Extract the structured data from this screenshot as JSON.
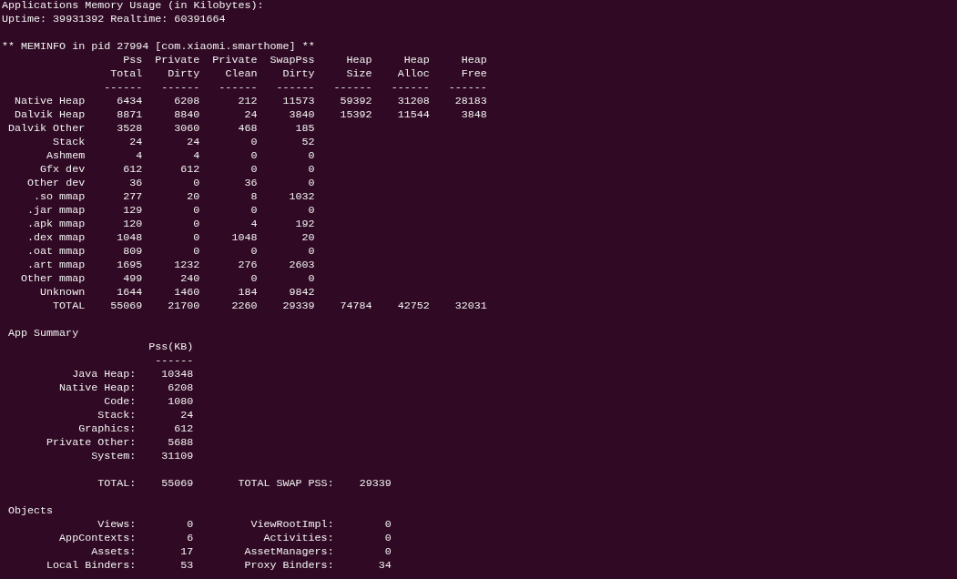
{
  "header": {
    "title": "Applications Memory Usage (in Kilobytes):",
    "uptime": "Uptime: 39931392 Realtime: 60391664"
  },
  "meminfo": {
    "title": "** MEMINFO in pid 27994 [com.xiaomi.smarthome] **",
    "columns": [
      {
        "line_1": "Pss",
        "line_2": "Total",
        "rule": "------"
      },
      {
        "line_1": "Private",
        "line_2": "Dirty",
        "rule": "------"
      },
      {
        "line_1": "Private",
        "line_2": "Clean",
        "rule": "------"
      },
      {
        "line_1": "SwapPss",
        "line_2": "Dirty",
        "rule": "------"
      },
      {
        "line_1": "Heap",
        "line_2": "Size",
        "rule": "------"
      },
      {
        "line_1": "Heap",
        "line_2": "Alloc",
        "rule": "------"
      },
      {
        "line_1": "Heap",
        "line_2": "Free",
        "rule": "------"
      }
    ],
    "rows": [
      {
        "label": "Native Heap",
        "cells": [
          "6434",
          "6208",
          "212",
          "11573",
          "59392",
          "31208",
          "28183"
        ]
      },
      {
        "label": "Dalvik Heap",
        "cells": [
          "8871",
          "8840",
          "24",
          "3840",
          "15392",
          "11544",
          "3848"
        ]
      },
      {
        "label": "Dalvik Other",
        "cells": [
          "3528",
          "3060",
          "468",
          "185"
        ]
      },
      {
        "label": "Stack",
        "cells": [
          "24",
          "24",
          "0",
          "52"
        ]
      },
      {
        "label": "Ashmem",
        "cells": [
          "4",
          "4",
          "0",
          "0"
        ]
      },
      {
        "label": "Gfx dev",
        "cells": [
          "612",
          "612",
          "0",
          "0"
        ]
      },
      {
        "label": "Other dev",
        "cells": [
          "36",
          "0",
          "36",
          "0"
        ]
      },
      {
        "label": ".so mmap",
        "cells": [
          "277",
          "20",
          "8",
          "1032"
        ]
      },
      {
        "label": ".jar mmap",
        "cells": [
          "129",
          "0",
          "0",
          "0"
        ]
      },
      {
        "label": ".apk mmap",
        "cells": [
          "120",
          "0",
          "4",
          "192"
        ]
      },
      {
        "label": ".dex mmap",
        "cells": [
          "1048",
          "0",
          "1048",
          "20"
        ]
      },
      {
        "label": ".oat mmap",
        "cells": [
          "809",
          "0",
          "0",
          "0"
        ]
      },
      {
        "label": ".art mmap",
        "cells": [
          "1695",
          "1232",
          "276",
          "2603"
        ]
      },
      {
        "label": "Other mmap",
        "cells": [
          "499",
          "240",
          "0",
          "0"
        ]
      },
      {
        "label": "Unknown",
        "cells": [
          "1644",
          "1460",
          "184",
          "9842"
        ]
      },
      {
        "label": "TOTAL",
        "cells": [
          "55069",
          "21700",
          "2260",
          "29339",
          "74784",
          "42752",
          "32031"
        ]
      }
    ]
  },
  "app_summary": {
    "title": "App Summary",
    "column": "Pss(KB)",
    "rule": "------",
    "rows": [
      {
        "label": "Java Heap:",
        "value": "10348"
      },
      {
        "label": "Native Heap:",
        "value": "6208"
      },
      {
        "label": "Code:",
        "value": "1080"
      },
      {
        "label": "Stack:",
        "value": "24"
      },
      {
        "label": "Graphics:",
        "value": "612"
      },
      {
        "label": "Private Other:",
        "value": "5688"
      },
      {
        "label": "System:",
        "value": "31109"
      }
    ],
    "total": {
      "label": "TOTAL:",
      "value": "55069",
      "swap_label": "TOTAL SWAP PSS:",
      "swap_value": "29339"
    }
  },
  "objects": {
    "title": "Objects",
    "rows": [
      {
        "label": "Views:",
        "value": "0",
        "label_2": "ViewRootImpl:",
        "value_2": "0"
      },
      {
        "label": "AppContexts:",
        "value": "6",
        "label_2": "Activities:",
        "value_2": "0"
      },
      {
        "label": "Assets:",
        "value": "17",
        "label_2": "AssetManagers:",
        "value_2": "0"
      },
      {
        "label": "Local Binders:",
        "value": "53",
        "label_2": "Proxy Binders:",
        "value_2": "34"
      }
    ]
  }
}
